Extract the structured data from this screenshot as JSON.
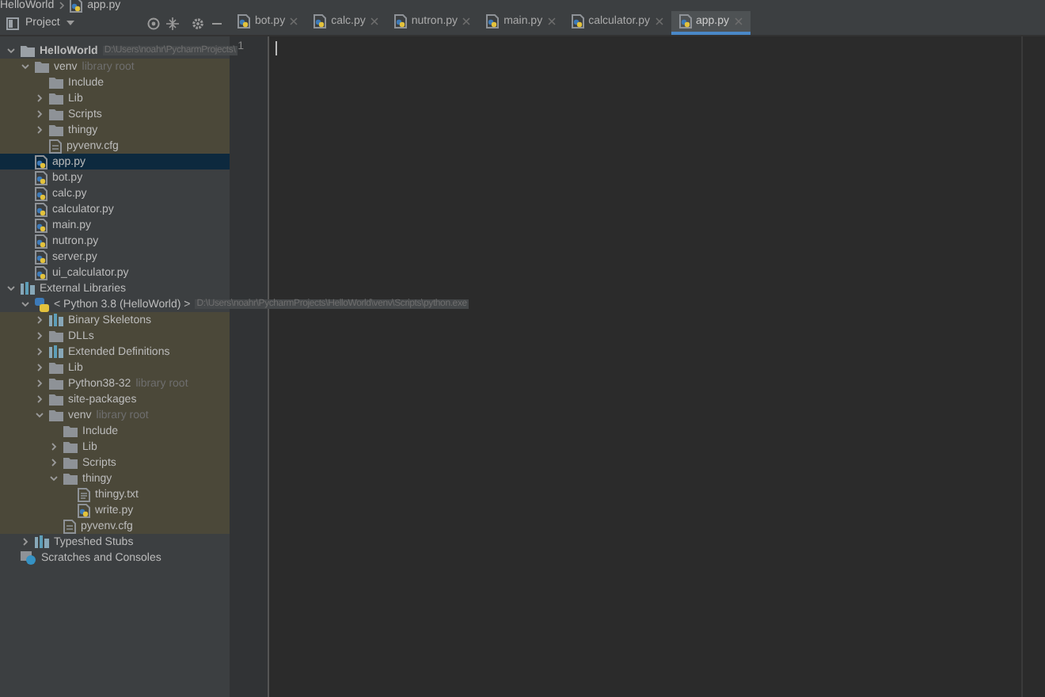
{
  "breadcrumb": [
    "HelloWorld",
    "app.py"
  ],
  "project_panel": {
    "title": "Project"
  },
  "tabs": [
    {
      "label": "bot.py",
      "selected": false
    },
    {
      "label": "calc.py",
      "selected": false
    },
    {
      "label": "nutron.py",
      "selected": false
    },
    {
      "label": "main.py",
      "selected": false
    },
    {
      "label": "calculator.py",
      "selected": false
    },
    {
      "label": "app.py",
      "selected": true
    }
  ],
  "tree": [
    {
      "kind": "project",
      "label": "HelloWorld",
      "path": "D:\\Users\\noahr\\PycharmProjects\\",
      "expanded": true,
      "highlighted": false,
      "selected": false,
      "children": [
        {
          "kind": "folder",
          "label": "venv",
          "hint": "library root",
          "expanded": true,
          "highlighted": true,
          "selected": false,
          "children": [
            {
              "kind": "folder",
              "label": "Include",
              "highlighted": true,
              "selected": false
            },
            {
              "kind": "folder",
              "label": "Lib",
              "expanded": false,
              "highlighted": true,
              "selected": false
            },
            {
              "kind": "folder",
              "label": "Scripts",
              "expanded": false,
              "highlighted": true,
              "selected": false
            },
            {
              "kind": "folder",
              "label": "thingy",
              "expanded": false,
              "highlighted": true,
              "selected": false
            },
            {
              "kind": "cfg",
              "label": "pyvenv.cfg",
              "highlighted": true,
              "selected": false
            }
          ]
        },
        {
          "kind": "py",
          "label": "app.py",
          "highlighted": false,
          "selected": true
        },
        {
          "kind": "py",
          "label": "bot.py",
          "highlighted": false,
          "selected": false
        },
        {
          "kind": "py",
          "label": "calc.py",
          "highlighted": false,
          "selected": false
        },
        {
          "kind": "py",
          "label": "calculator.py",
          "highlighted": false,
          "selected": false
        },
        {
          "kind": "py",
          "label": "main.py",
          "highlighted": false,
          "selected": false
        },
        {
          "kind": "py",
          "label": "nutron.py",
          "highlighted": false,
          "selected": false
        },
        {
          "kind": "py",
          "label": "server.py",
          "highlighted": false,
          "selected": false
        },
        {
          "kind": "py",
          "label": "ui_calculator.py",
          "highlighted": false,
          "selected": false
        }
      ]
    },
    {
      "kind": "library",
      "label": "External Libraries",
      "expanded": true,
      "highlighted": false,
      "selected": false,
      "children": [
        {
          "kind": "sdk",
          "label": "< Python 3.8 (HelloWorld) >",
          "path": "D:\\Users\\noahr\\PycharmProjects\\HelloWorld\\venv\\Scripts\\python.exe",
          "expanded": true,
          "highlighted": false,
          "selected": false,
          "children": [
            {
              "kind": "library",
              "label": "Binary Skeletons",
              "expanded": false,
              "highlighted": true,
              "selected": false
            },
            {
              "kind": "folder",
              "label": "DLLs",
              "expanded": false,
              "highlighted": true,
              "selected": false
            },
            {
              "kind": "library",
              "label": "Extended Definitions",
              "expanded": false,
              "highlighted": true,
              "selected": false
            },
            {
              "kind": "folder",
              "label": "Lib",
              "expanded": false,
              "highlighted": true,
              "selected": false
            },
            {
              "kind": "folder",
              "label": "Python38-32",
              "hint": "library root",
              "expanded": false,
              "highlighted": true,
              "selected": false
            },
            {
              "kind": "folder",
              "label": "site-packages",
              "expanded": false,
              "highlighted": true,
              "selected": false
            },
            {
              "kind": "folder",
              "label": "venv",
              "hint": "library root",
              "expanded": true,
              "highlighted": true,
              "selected": false,
              "children": [
                {
                  "kind": "folder",
                  "label": "Include",
                  "highlighted": true,
                  "selected": false
                },
                {
                  "kind": "folder",
                  "label": "Lib",
                  "expanded": false,
                  "highlighted": true,
                  "selected": false
                },
                {
                  "kind": "folder",
                  "label": "Scripts",
                  "expanded": false,
                  "highlighted": true,
                  "selected": false
                },
                {
                  "kind": "folder",
                  "label": "thingy",
                  "expanded": true,
                  "highlighted": true,
                  "selected": false,
                  "children": [
                    {
                      "kind": "txt",
                      "label": "thingy.txt",
                      "highlighted": true,
                      "selected": false
                    },
                    {
                      "kind": "py",
                      "label": "write.py",
                      "highlighted": true,
                      "selected": false
                    }
                  ]
                },
                {
                  "kind": "cfg",
                  "label": "pyvenv.cfg",
                  "highlighted": true,
                  "selected": false
                }
              ]
            }
          ]
        },
        {
          "kind": "library",
          "label": "Typeshed Stubs",
          "expanded": false,
          "highlighted": false,
          "selected": false
        }
      ]
    },
    {
      "kind": "scratch",
      "label": "Scratches and Consoles",
      "highlighted": false,
      "selected": false
    }
  ],
  "editor": {
    "line_numbers": [
      "1"
    ]
  }
}
